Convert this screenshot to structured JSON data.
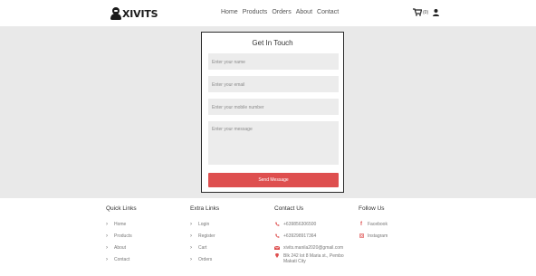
{
  "brand": {
    "name": "XIVITS"
  },
  "nav": {
    "links": [
      "Home",
      "Products",
      "Orders",
      "About",
      "Contact"
    ],
    "cart_count": "(0)"
  },
  "form": {
    "title": "Get In Touch",
    "name_placeholder": "Enter your name",
    "email_placeholder": "Enter your email",
    "mobile_placeholder": "Enter your mobile number",
    "message_placeholder": "Enter your message",
    "send_label": "Send Message"
  },
  "footer": {
    "quick_links": {
      "title": "Quick Links",
      "items": [
        "Home",
        "Products",
        "About",
        "Contact"
      ]
    },
    "extra_links": {
      "title": "Extra Links",
      "items": [
        "Login",
        "Register",
        "Cart",
        "Orders"
      ]
    },
    "contact": {
      "title": "Contact Us",
      "phone1": "+639856306500",
      "phone2": "+639298917364",
      "email": "xivits.manila2020@gmail.com",
      "address_line1": "Blk 242 lot 8 Maria st., Pembo",
      "address_line2": "Makati City"
    },
    "follow": {
      "title": "Follow Us",
      "facebook": "Facebook",
      "instagram": "Instagram"
    }
  },
  "colors": {
    "accent": "#de4f4f",
    "page_bg": "#e9e9e9",
    "field_bg": "#ececec"
  }
}
